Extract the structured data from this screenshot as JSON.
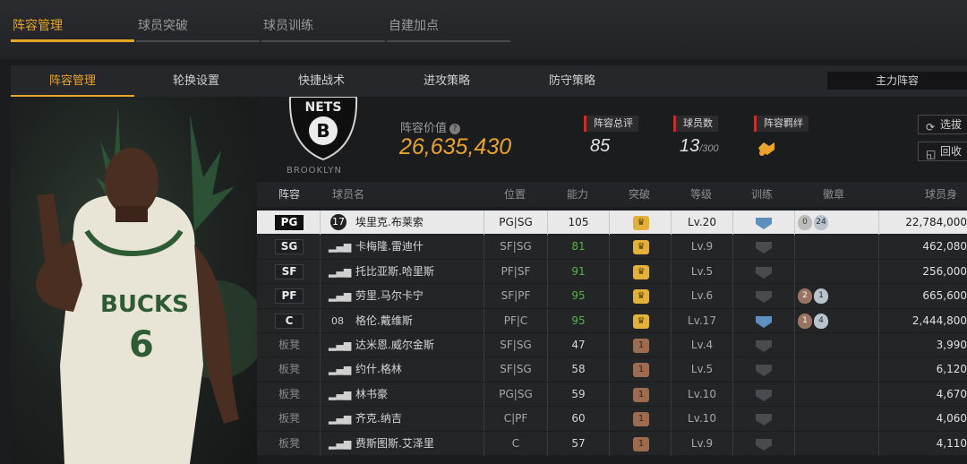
{
  "top_tabs": [
    {
      "label": "阵容管理",
      "active": true
    },
    {
      "label": "球员突破",
      "active": false
    },
    {
      "label": "球员训练",
      "active": false
    },
    {
      "label": "自建加点",
      "active": false
    }
  ],
  "sub_tabs": [
    {
      "label": "阵容管理",
      "active": true
    },
    {
      "label": "轮换设置",
      "active": false
    },
    {
      "label": "快捷战术",
      "active": false
    },
    {
      "label": "进攻策略",
      "active": false
    },
    {
      "label": "防守策略",
      "active": false
    }
  ],
  "lineup_button": "主力阵容",
  "team": {
    "logo_text": "NETS",
    "logo_badge": "B",
    "name": "BROOKLYN"
  },
  "lineup_value": {
    "label": "阵容价值",
    "value": "26,635,430"
  },
  "stats": {
    "rating": {
      "label": "阵容总评",
      "value": "85"
    },
    "players": {
      "label": "球员数",
      "value": "13",
      "max": "/300"
    },
    "bond": {
      "label": "阵容羁绊"
    }
  },
  "side_buttons": {
    "scout": "选拔",
    "recycle": "回收"
  },
  "player_card": {
    "team": "BUCKS",
    "number": "6"
  },
  "table": {
    "headers": [
      "阵容",
      "球员名",
      "位置",
      "能力",
      "突破",
      "等级",
      "训练",
      "徽章",
      "球员身价"
    ],
    "rows": [
      {
        "slot": "PG",
        "starter": true,
        "selected": true,
        "num": "17",
        "name": "埃里克.布莱索",
        "pos": "PG|SG",
        "ability": "105",
        "ability_color": "#1a1a1a",
        "break": "crown",
        "level": "Lv.20",
        "train": true,
        "badges": [
          {
            "t": "grey",
            "v": "0"
          },
          {
            "t": "silver",
            "v": "24"
          }
        ],
        "price": "22,784,000"
      },
      {
        "slot": "SG",
        "starter": true,
        "selected": false,
        "num": "",
        "name": "卡梅隆.雷迪什",
        "pos": "SF|SG",
        "ability": "81",
        "ability_color": "#56b349",
        "break": "crown",
        "level": "Lv.9",
        "train": false,
        "badges": [],
        "price": "462,080"
      },
      {
        "slot": "SF",
        "starter": true,
        "selected": false,
        "num": "",
        "name": "托比亚斯.哈里斯",
        "pos": "PF|SF",
        "ability": "91",
        "ability_color": "#56b349",
        "break": "crown",
        "level": "Lv.5",
        "train": false,
        "badges": [],
        "price": "256,000"
      },
      {
        "slot": "PF",
        "starter": true,
        "selected": false,
        "num": "",
        "name": "劳里.马尔卡宁",
        "pos": "SF|PF",
        "ability": "95",
        "ability_color": "#56b349",
        "break": "crown",
        "level": "Lv.6",
        "train": false,
        "badges": [
          {
            "t": "bronze",
            "v": "2"
          },
          {
            "t": "silver",
            "v": "1"
          }
        ],
        "price": "665,600"
      },
      {
        "slot": "C",
        "starter": true,
        "selected": false,
        "num": "08",
        "name": "格伦.戴维斯",
        "pos": "PF|C",
        "ability": "95",
        "ability_color": "#56b349",
        "break": "crown",
        "level": "Lv.17",
        "train": true,
        "badges": [
          {
            "t": "bronze",
            "v": "1"
          },
          {
            "t": "silver",
            "v": "4"
          }
        ],
        "price": "2,444,800"
      },
      {
        "slot": "板凳",
        "starter": false,
        "selected": false,
        "num": "",
        "name": "达米恩.威尔金斯",
        "pos": "SF|SG",
        "ability": "47",
        "ability_color": "#d6d6d6",
        "break": "bronze",
        "level": "Lv.4",
        "train": false,
        "badges": [],
        "price": "3,990"
      },
      {
        "slot": "板凳",
        "starter": false,
        "selected": false,
        "num": "",
        "name": "约什.格林",
        "pos": "SF|SG",
        "ability": "58",
        "ability_color": "#d6d6d6",
        "break": "bronze",
        "level": "Lv.5",
        "train": false,
        "badges": [],
        "price": "6,120"
      },
      {
        "slot": "板凳",
        "starter": false,
        "selected": false,
        "num": "",
        "name": "林书豪",
        "pos": "PG|SG",
        "ability": "59",
        "ability_color": "#d6d6d6",
        "break": "bronze",
        "level": "Lv.10",
        "train": false,
        "badges": [],
        "price": "4,670"
      },
      {
        "slot": "板凳",
        "starter": false,
        "selected": false,
        "num": "",
        "name": "齐克.纳吉",
        "pos": "C|PF",
        "ability": "60",
        "ability_color": "#d6d6d6",
        "break": "bronze",
        "level": "Lv.10",
        "train": false,
        "badges": [],
        "price": "4,060"
      },
      {
        "slot": "板凳",
        "starter": false,
        "selected": false,
        "num": "",
        "name": "费斯图斯.艾泽里",
        "pos": "C",
        "ability": "57",
        "ability_color": "#d6d6d6",
        "break": "bronze",
        "level": "Lv.9",
        "train": false,
        "badges": [],
        "price": "4,110"
      }
    ]
  },
  "colors": {
    "accent": "#e9a42c",
    "red": "#c4302b",
    "green": "#56b349"
  }
}
